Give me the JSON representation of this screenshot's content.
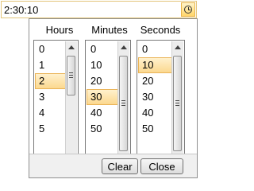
{
  "time_input": {
    "value": "2:30:10",
    "button_icon": "clock-icon"
  },
  "picker": {
    "columns": [
      {
        "header": "Hours",
        "items": [
          "0",
          "1",
          "2",
          "3",
          "4",
          "5"
        ],
        "selected": "2"
      },
      {
        "header": "Minutes",
        "items": [
          "0",
          "10",
          "20",
          "30",
          "40",
          "50"
        ],
        "selected": "30"
      },
      {
        "header": "Seconds",
        "items": [
          "0",
          "10",
          "20",
          "30",
          "40",
          "50"
        ],
        "selected": "10"
      }
    ],
    "buttons": {
      "clear": "Clear",
      "close": "Close"
    }
  }
}
